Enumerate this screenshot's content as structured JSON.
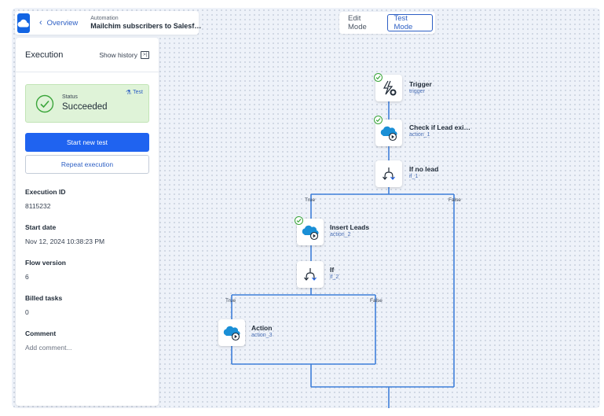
{
  "header": {
    "back_label": "Overview",
    "crumb_small": "Automation",
    "crumb_title": "Mailchim subscribers to Salesf…"
  },
  "modes": [
    {
      "label": "Edit Mode",
      "active": false
    },
    {
      "label": "Test Mode",
      "active": true
    }
  ],
  "execution": {
    "title": "Execution",
    "show_history": "Show history",
    "status_label": "Status",
    "status_value": "Succeeded",
    "test_badge": "Test",
    "start_new_test": "Start new test",
    "repeat_execution": "Repeat execution",
    "fields": [
      {
        "key": "Execution ID",
        "value": "8115232"
      },
      {
        "key": "Start date",
        "value": "Nov 12, 2024 10:38:23 PM"
      },
      {
        "key": "Flow version",
        "value": "6"
      },
      {
        "key": "Billed tasks",
        "value": "0"
      }
    ],
    "comment_label": "Comment",
    "comment_placeholder": "Add comment..."
  },
  "flow": {
    "nodes": [
      {
        "title": "Trigger",
        "id": "trigger",
        "icon": "trigger-bolt-icon",
        "succeeded": true
      },
      {
        "title": "Check if Lead exi…",
        "id": "action_1",
        "icon": "salesforce-run-icon",
        "succeeded": true
      },
      {
        "title": "If no lead",
        "id": "if_1",
        "icon": "branch-icon",
        "succeeded": false
      },
      {
        "title": "Insert Leads",
        "id": "action_2",
        "icon": "salesforce-run-icon",
        "succeeded": true
      },
      {
        "title": "If",
        "id": "if_2",
        "icon": "branch-icon",
        "succeeded": false
      },
      {
        "title": "Action",
        "id": "action_3",
        "icon": "salesforce-run-icon",
        "succeeded": false
      }
    ],
    "branch_true": "True",
    "branch_false": "False"
  },
  "colors": {
    "accent": "#1f63f0",
    "connector": "#3f7fd9",
    "success": "#3aa53a",
    "status_bg": "#dff3d8"
  }
}
